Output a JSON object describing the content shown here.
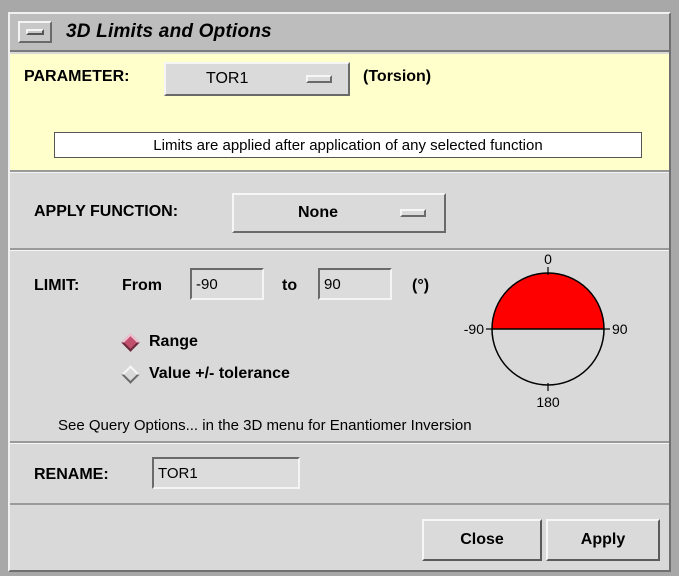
{
  "window": {
    "title": "3D Limits and Options"
  },
  "parameter": {
    "label": "PARAMETER:",
    "value": "TOR1",
    "kind": "(Torsion)"
  },
  "note": "Limits are applied after application of any selected function",
  "apply_function": {
    "label": "APPLY FUNCTION:",
    "value": "None"
  },
  "limit": {
    "label": "LIMIT:",
    "from_label": "From",
    "from_value": "-90",
    "to_label": "to",
    "to_value": "90",
    "unit": "(°)",
    "range_label": "Range",
    "tolerance_label": "Value +/- tolerance",
    "selected_mode": "Range",
    "dial": {
      "top": "0",
      "left": "-90",
      "right": "90",
      "bottom": "180",
      "fill_color": "#ff0000"
    }
  },
  "hint": "See Query Options... in the 3D menu for Enantiomer Inversion",
  "rename": {
    "label": "RENAME:",
    "value": "TOR1"
  },
  "buttons": {
    "close": "Close",
    "apply": "Apply"
  }
}
